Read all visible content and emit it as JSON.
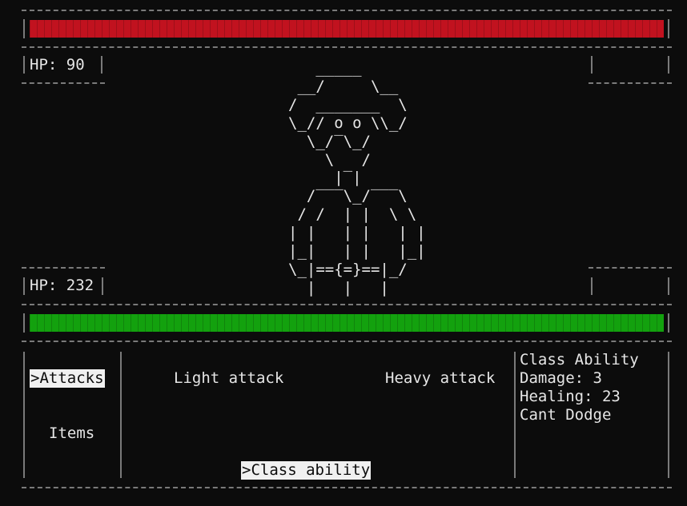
{
  "enemy": {
    "hp_label": "HP: 90",
    "bar_fraction": 1.0,
    "bar_color": "#c1121f"
  },
  "player": {
    "hp_label": "HP: 232",
    "bar_fraction": 1.0,
    "bar_color": "#13a10e"
  },
  "sprite": {
    "ascii": "   _____\n __/     \\__\n/  _______  \\\n\\_// o o \\\\_/\n  \\_/‾\\_/\n    \\   /\n     |‾|\n  /‾‾‾\\_/‾‾‾\\\n / /  | |  \\ \\\n| |   | |   | |\n|_|   | |   |_|\n\\_|=={=}==|_/\n  |   |   |"
  },
  "menu": {
    "categories": [
      {
        "label": ">Attacks",
        "selected": true
      },
      {
        "label": "Items",
        "selected": false
      }
    ],
    "options": [
      {
        "label": "Light attack",
        "selected": false
      },
      {
        "label": "Heavy attack",
        "selected": false
      },
      {
        "label": ">Class ability",
        "selected": true
      }
    ]
  },
  "info": {
    "lines": [
      "Class Ability",
      "Damage: 3",
      "Healing: 23",
      "Cant Dodge"
    ]
  }
}
